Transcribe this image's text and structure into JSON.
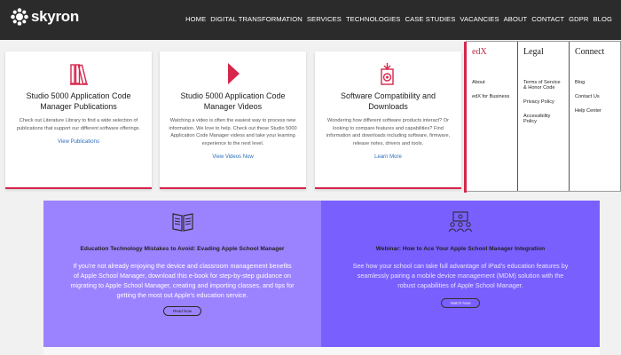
{
  "brand": {
    "name": "skyron",
    "accent": "#d6264c",
    "link": "#2a6ebb"
  },
  "nav": [
    "HOME",
    "DIGITAL TRANSFORMATION",
    "SERVICES",
    "TECHNOLOGIES",
    "CASE STUDIES",
    "VACANCIES",
    "ABOUT",
    "CONTACT",
    "GDPR",
    "BLOG"
  ],
  "cards": [
    {
      "icon": "books-icon",
      "title": "Studio 5000 Application Code Manager Publications",
      "body": "Check out Literature Library to find a wide selection of publications that support our different software offerings.",
      "link": "View Publications"
    },
    {
      "icon": "play-icon",
      "title": "Studio 5000 Application Code Manager Videos",
      "body": "Watching a video is often the easiest way to process new information. We love to help. Check out these Studio 5000 Application Code Manager videos and take your learning experience to the next level.",
      "link": "View Videos Now"
    },
    {
      "icon": "compatibility-icon",
      "title": "Software Compatibility and Downloads",
      "body": "Wondering how different software products interact? Or looking to compare features and capabilities? Find information and downloads including software, firmware, release notes, drivers and tools.",
      "link": "Learn More"
    }
  ],
  "dropdown": {
    "columns": [
      {
        "title": "edX",
        "items": [
          "About",
          "edX for Business"
        ]
      },
      {
        "title": "Legal",
        "items": [
          "Terms of Service & Honor Code",
          "Privacy Policy",
          "Accessibility Policy"
        ]
      },
      {
        "title": "Connect",
        "items": [
          "Blog",
          "Contact Us",
          "Help Center"
        ]
      }
    ]
  },
  "panels": [
    {
      "icon": "book-open-icon",
      "title": "Education Technology Mistakes to Avoid: Evading Apple School Manager",
      "body": "If you're not already enjoying the device and classroom management benefits of Apple School Manager, download this e-book for step-by-step guidance on migrating to Apple School Manager, creating and importing classes, and tips for getting the most out Apple's education service.",
      "button": "Read Now"
    },
    {
      "icon": "classroom-icon",
      "title": "Webinar: How to Ace Your Apple School Manager Integration",
      "body": "See how your school can take full advantage of iPad's education features by seamlessly pairing a mobile device management (MDM) solution with the robust capabilities of Apple School Manager.",
      "button": "Watch Now"
    }
  ]
}
